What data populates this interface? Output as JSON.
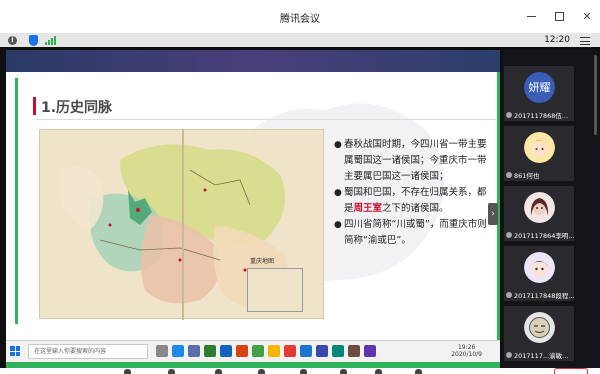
{
  "window": {
    "title": "腾讯会议"
  },
  "status": {
    "time": "12:20"
  },
  "slide": {
    "heading": "1.历史同脉",
    "map_legend_title": "重庆地图",
    "bullets": [
      {
        "text_before": "春秋战国时期，今四川省一带主要属蜀国这一诸侯国；今重庆市一带主要属巴国这一诸侯国；",
        "highlight": "",
        "text_after": ""
      },
      {
        "text_before": "蜀国和巴国，不存在归属关系，都是",
        "highlight": "周王室",
        "text_after": "之下的诸侯国。"
      },
      {
        "text_before": "四川省简称“川或蜀”，而重庆市则简称“渝或巴”。",
        "highlight": "",
        "text_after": ""
      }
    ]
  },
  "taskbar": {
    "search_placeholder": "在这里输入你要搜索的内容",
    "time": "19:26",
    "date": "2020/10/9"
  },
  "participants": [
    {
      "avatar_text": "妍耀",
      "name": "2017117868伍..."
    },
    {
      "avatar_text": "",
      "name": "861何也"
    },
    {
      "avatar_text": "",
      "name": "2017117864李明..."
    },
    {
      "avatar_text": "",
      "name": "2017117848段程..."
    },
    {
      "avatar_text": "",
      "name": "2017117...渝敏..."
    }
  ],
  "colors": {
    "accent_green": "#2fb35a",
    "accent_red": "#c8102e",
    "avatar_blue": "#3a5db8"
  }
}
